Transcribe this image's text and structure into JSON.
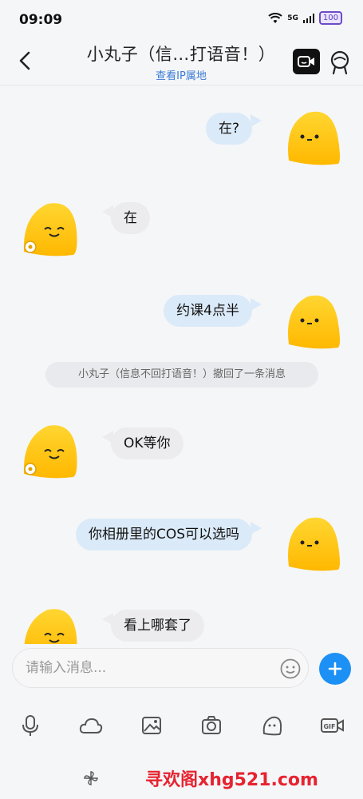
{
  "status": {
    "time": "09:09",
    "network": "5G",
    "battery": "100"
  },
  "header": {
    "title": "小丸子（信…打语音！）",
    "subtitle": "查看IP属地"
  },
  "messages": [
    {
      "side": "me",
      "text": "在?"
    },
    {
      "side": "them",
      "text": "在"
    },
    {
      "side": "me",
      "text": "约课4点半"
    },
    {
      "side": "system",
      "text": "小丸子（信息不回打语音！）撤回了一条消息"
    },
    {
      "side": "them",
      "text": "OK等你"
    },
    {
      "side": "me",
      "text": "你相册里的COS可以选吗"
    },
    {
      "side": "them",
      "text": "看上哪套了"
    }
  ],
  "input": {
    "placeholder": "请输入消息..."
  },
  "toolbar": [
    {
      "icon": "microphone-icon"
    },
    {
      "icon": "cloud-icon"
    },
    {
      "icon": "image-icon"
    },
    {
      "icon": "camera-icon"
    },
    {
      "icon": "sticker-icon"
    },
    {
      "icon": "gif-icon",
      "text": "GIF"
    }
  ],
  "footer": {
    "watermark": "寻欢阁xhg521.com"
  },
  "colors": {
    "accent": "#1d90f5",
    "my_bubble": "#dbeaf8",
    "their_bubble": "#ececee",
    "watermark": "#e6232f"
  }
}
